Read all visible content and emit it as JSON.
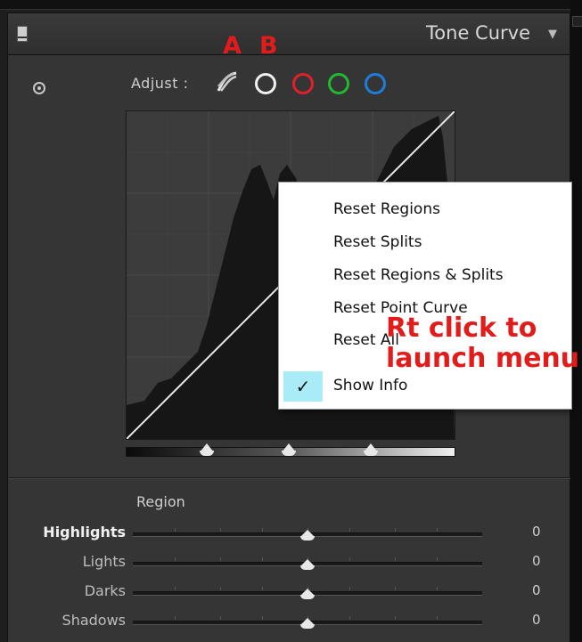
{
  "panel": {
    "title": "Tone Curve",
    "collapse_icon": "panel-collapse-icon",
    "menu_arrow": "▼"
  },
  "adjust": {
    "label": "Adjust :",
    "channels": [
      {
        "id": "parametric",
        "icon": "parametric-curve-icon"
      },
      {
        "id": "rgb",
        "icon": "rgb-channel-icon",
        "color": "#f0f0f0"
      },
      {
        "id": "red",
        "icon": "red-channel-icon",
        "color": "#e0202a"
      },
      {
        "id": "green",
        "icon": "green-channel-icon",
        "color": "#21b830"
      },
      {
        "id": "blue",
        "icon": "blue-channel-icon",
        "color": "#1e7ddc"
      }
    ],
    "annotation_a": "A",
    "annotation_b": "B"
  },
  "context_menu": {
    "items": [
      {
        "label": "Reset Regions",
        "checked": false
      },
      {
        "label": "Reset Splits",
        "checked": false
      },
      {
        "label": "Reset Regions & Splits",
        "checked": false
      },
      {
        "label": "Reset Point Curve",
        "checked": false
      },
      {
        "label": "Reset All",
        "checked": false
      },
      {
        "label": "Show Info",
        "checked": true
      }
    ],
    "check_glyph": "✓"
  },
  "callout": {
    "line1": "Rt click to",
    "line2": "launch menu",
    "color": "#e21b1b"
  },
  "region": {
    "title": "Region",
    "sliders": [
      {
        "label": "Highlights",
        "value": "0",
        "active": true
      },
      {
        "label": "Lights",
        "value": "0",
        "active": false
      },
      {
        "label": "Darks",
        "value": "0",
        "active": false
      },
      {
        "label": "Shadows",
        "value": "0",
        "active": false
      }
    ]
  }
}
